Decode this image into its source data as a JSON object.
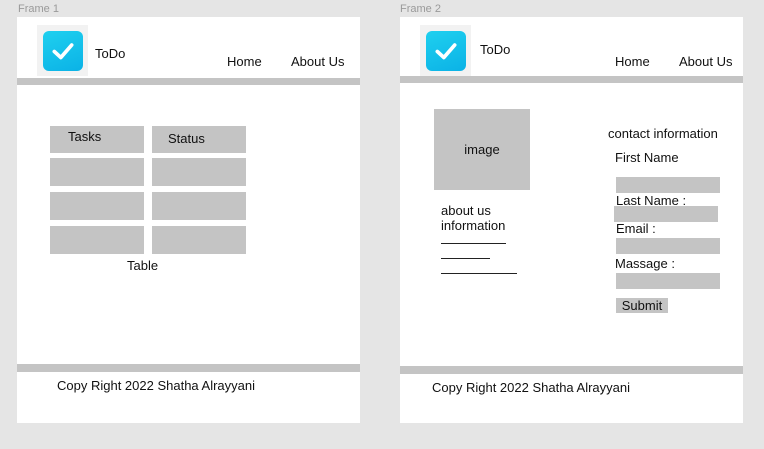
{
  "frames": [
    {
      "label": "Frame 1",
      "header": {
        "app_name": "ToDo",
        "nav": [
          "Home",
          "About Us"
        ]
      },
      "table": {
        "headers": [
          "Tasks",
          "Status"
        ],
        "rows": [
          [
            "",
            ""
          ],
          [
            "",
            ""
          ],
          [
            "",
            ""
          ]
        ],
        "caption": "Table"
      },
      "footer": "Copy Right 2022 Shatha Alrayyani"
    },
    {
      "label": "Frame 2",
      "header": {
        "app_name": "ToDo",
        "nav": [
          "Home",
          "About Us"
        ]
      },
      "about": {
        "image_label": "image",
        "info_line1": "about us",
        "info_line2": "information"
      },
      "contact": {
        "title": "contact information",
        "fields": [
          "First Name",
          "Last Name :",
          "Email :",
          "Massage :"
        ],
        "submit_label": "Submit"
      },
      "footer": "Copy Right 2022 Shatha Alrayyani"
    }
  ],
  "colors": {
    "logo_gradient_start": "#1fd0ef",
    "logo_gradient_end": "#0bb2e6",
    "placeholder_gray": "#c4c4c4"
  },
  "icons": {
    "logo": "checkmark-icon"
  }
}
